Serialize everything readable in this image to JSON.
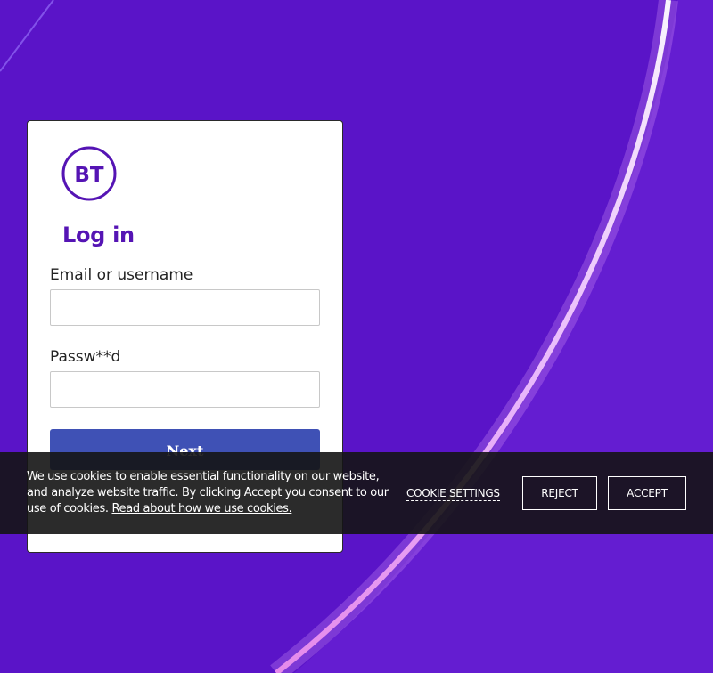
{
  "brand": {
    "logo_text": "BT",
    "color": "#5514b4"
  },
  "login": {
    "title": "Log in",
    "email_label": "Email or username",
    "email_value": "",
    "password_label": "Passw**d",
    "password_value": "",
    "next_label": "Next"
  },
  "cookies": {
    "message": "We use cookies to enable essential functionality on our website, and analyze website traffic. By clicking Accept you consent to our use of cookies.",
    "link_label": "Read about how we use cookies.",
    "settings_label": "COOKIE SETTINGS",
    "reject_label": "REJECT",
    "accept_label": "ACCEPT"
  },
  "colors": {
    "background": "#5a14c8",
    "button": "#3f51b5",
    "cookie_bar": "#141414"
  }
}
